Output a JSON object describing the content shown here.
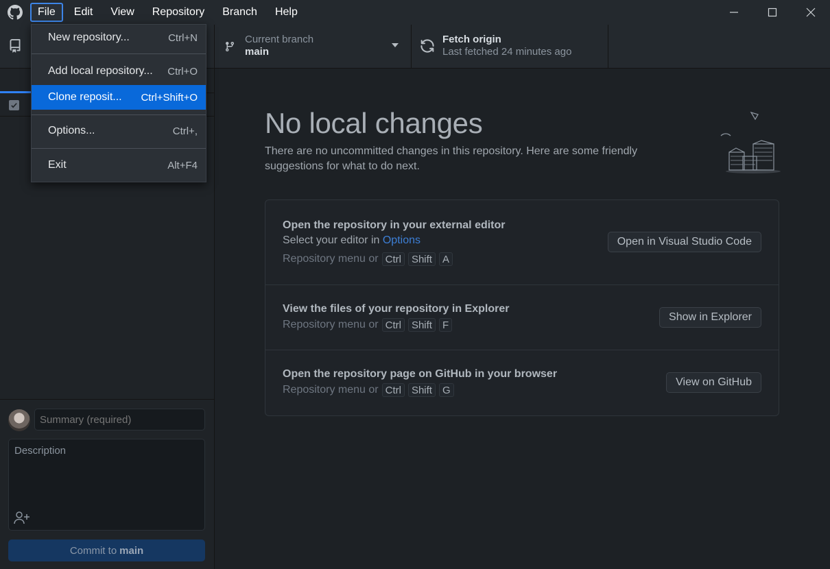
{
  "menu_bar": {
    "items": [
      "File",
      "Edit",
      "View",
      "Repository",
      "Branch",
      "Help"
    ],
    "active": "File"
  },
  "toolbar": {
    "branch_label": "Current branch",
    "branch_value": "main",
    "fetch_label": "Fetch origin",
    "fetch_sub": "Last fetched 24 minutes ago"
  },
  "file_menu": {
    "items": [
      {
        "label": "New repository...",
        "shortcut": "Ctrl+N"
      },
      {
        "label": "Add local repository...",
        "shortcut": "Ctrl+O"
      },
      {
        "label": "Clone reposit...",
        "shortcut": "Ctrl+Shift+O"
      },
      {
        "label": "Options...",
        "shortcut": "Ctrl+,"
      },
      {
        "label": "Exit",
        "shortcut": "Alt+F4"
      }
    ],
    "highlighted": "Clone reposit..."
  },
  "commit": {
    "summary_placeholder": "Summary (required)",
    "description_placeholder": "Description",
    "button_prefix": "Commit to",
    "button_branch": "main"
  },
  "main": {
    "heading": "No local changes",
    "subtext": "There are no uncommitted changes in this repository. Here are some friendly suggestions for what to do next.",
    "suggestions": [
      {
        "title": "Open the repository in your external editor",
        "sub_prefix": "Select your editor in",
        "sub_link": "Options",
        "hint_prefix": "Repository menu or",
        "keys": [
          "Ctrl",
          "Shift",
          "A"
        ],
        "button": "Open in Visual Studio Code"
      },
      {
        "title": "View the files of your repository in Explorer",
        "hint_prefix": "Repository menu or",
        "keys": [
          "Ctrl",
          "Shift",
          "F"
        ],
        "button": "Show in Explorer"
      },
      {
        "title": "Open the repository page on GitHub in your browser",
        "hint_prefix": "Repository menu or",
        "keys": [
          "Ctrl",
          "Shift",
          "G"
        ],
        "button": "View on GitHub"
      }
    ]
  },
  "colors": {
    "accent": "#0969da",
    "link": "#3d7fd6",
    "background": "#1d2125"
  }
}
